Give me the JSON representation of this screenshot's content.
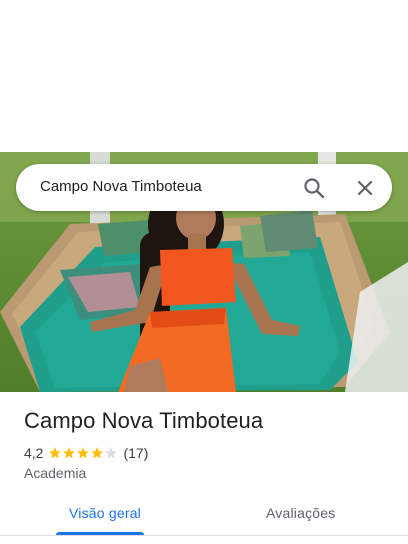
{
  "search": {
    "query": "Campo Nova Timboteua"
  },
  "place": {
    "name": "Campo Nova Timboteua",
    "rating": "4,2",
    "rating_value": 4.2,
    "review_count": "(17)",
    "category": "Academia"
  },
  "tabs": [
    {
      "label": "Visão geral",
      "active": true
    },
    {
      "label": "Avaliações",
      "active": false
    }
  ],
  "colors": {
    "accent": "#1a73e8",
    "star": "#fbbc04",
    "star_empty": "#dadce0"
  },
  "icons": [
    "search-icon",
    "close-icon",
    "star-icon"
  ]
}
